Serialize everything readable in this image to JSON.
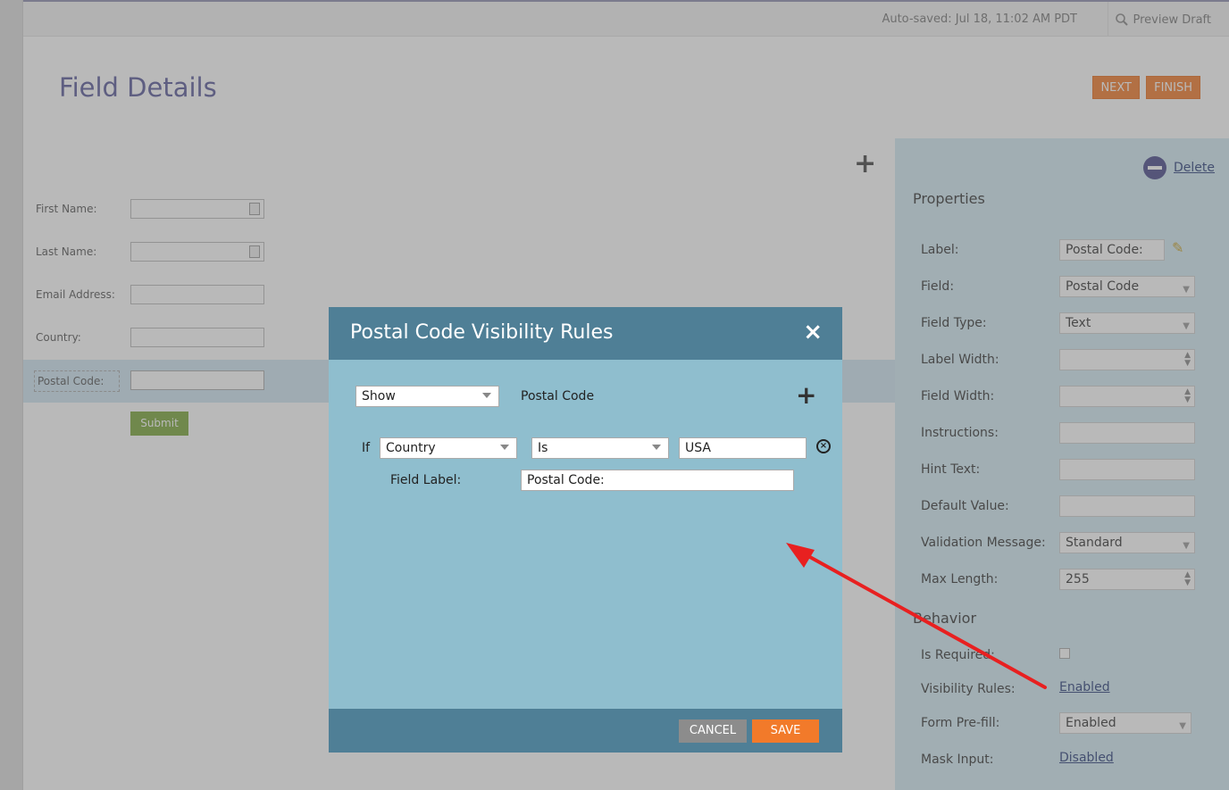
{
  "topbar": {
    "autosave": "Auto-saved: Jul 18, 11:02 AM PDT",
    "preview": "Preview Draft",
    "preview_icon": "magnifier-icon"
  },
  "header": {
    "title": "Field Details",
    "next_label": "NEXT",
    "finish_label": "FINISH"
  },
  "form": {
    "fields": [
      {
        "label": "First Name:"
      },
      {
        "label": "Last Name:"
      },
      {
        "label": "Email Address:"
      },
      {
        "label": "Country:"
      }
    ],
    "postal_label": "Postal Code:",
    "submit_label": "Submit"
  },
  "properties": {
    "delete_label": "Delete",
    "title": "Properties",
    "label_label": "Label:",
    "label_value": "Postal Code:",
    "field_label": "Field:",
    "field_value": "Postal Code",
    "field_type_label": "Field Type:",
    "field_type_value": "Text",
    "label_width_label": "Label Width:",
    "field_width_label": "Field Width:",
    "instructions_label": "Instructions:",
    "hint_text_label": "Hint Text:",
    "default_value_label": "Default Value:",
    "validation_message_label": "Validation Message:",
    "validation_message_value": "Standard",
    "max_length_label": "Max Length:",
    "max_length_value": "255",
    "behavior_title": "Behavior",
    "is_required_label": "Is Required:",
    "visibility_rules_label": "Visibility Rules:",
    "visibility_rules_value": "Enabled",
    "form_prefill_label": "Form Pre-fill:",
    "form_prefill_value": "Enabled",
    "mask_input_label": "Mask Input:",
    "mask_input_value": "Disabled"
  },
  "modal": {
    "title": "Postal Code Visibility Rules",
    "close": "×",
    "action_value": "Show",
    "target_field": "Postal Code",
    "add_rule": "+",
    "if_label": "If",
    "condition_field": "Country",
    "operator": "Is",
    "condition_value": "USA",
    "remove": "×",
    "field_label_label": "Field Label:",
    "field_label_value": "Postal Code:",
    "cancel_label": "CANCEL",
    "save_label": "SAVE"
  },
  "colors": {
    "accent_orange": "#f27a2a",
    "modal_header": "#4f7f96",
    "modal_body": "#8fbece",
    "arrow": "#e82020"
  }
}
